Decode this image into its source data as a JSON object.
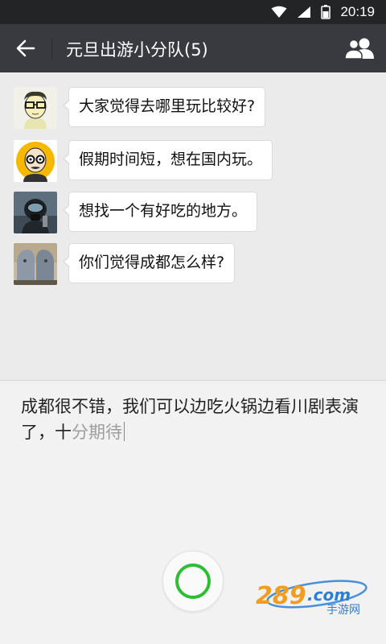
{
  "status_bar": {
    "time": "20:19",
    "icons": [
      "wifi-icon",
      "signal-icon",
      "battery-icon"
    ]
  },
  "header": {
    "title": "元旦出游小分队(5)",
    "back_icon": "back-arrow-icon",
    "members_icon": "group-members-icon"
  },
  "messages": [
    {
      "sender_avatar": "avatar-glasses-man",
      "text": "大家觉得去哪里玩比较好?"
    },
    {
      "sender_avatar": "avatar-bald-cartoon",
      "text": "假期时间短，想在国内玩。"
    },
    {
      "sender_avatar": "avatar-diver",
      "text": "想找一个有好吃的地方。"
    },
    {
      "sender_avatar": "avatar-album-faces",
      "text": "你们觉得成都怎么样?"
    }
  ],
  "input": {
    "committed_text": "成都很不错，我们可以边吃火锅边看川剧表演了，十",
    "pending_text": "分期待"
  },
  "voice_button_icon": "voice-input-icon",
  "watermark": {
    "text": "289.com",
    "subtext": "手游网"
  },
  "colors": {
    "title_bar": "#393a3f",
    "status_bar": "#222426",
    "chat_background": "#ebebeb",
    "voice_accent": "#2ebd35",
    "watermark_orange": "#f39c1f",
    "watermark_blue": "#2c7fd1"
  }
}
